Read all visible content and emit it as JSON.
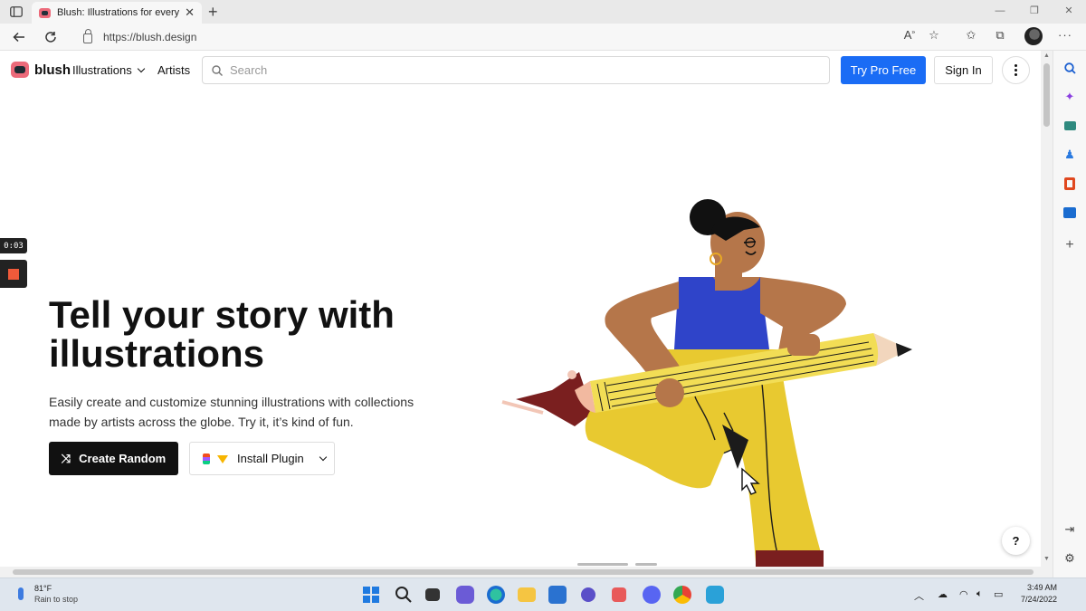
{
  "browser": {
    "tab_title": "Blush: Illustrations for everyone",
    "tab_close": "✕",
    "new_tab": "+",
    "url": "https://blush.design",
    "window_controls": [
      "—",
      "❐",
      "✕"
    ],
    "more_label": "···"
  },
  "site": {
    "logo_text": "blush",
    "nav_illustrations": "Illustrations",
    "nav_artists": "Artists",
    "search_placeholder": "Search",
    "try_pro": "Try Pro Free",
    "sign_in": "Sign In"
  },
  "hero": {
    "title": "Tell your story with illustrations",
    "subtitle": "Easily create and customize stunning illustrations with collections made by artists across the globe. Try it, it’s kind of fun.",
    "create_random": "Create Random",
    "install_plugin": "Install Plugin",
    "help": "?"
  },
  "recorder": {
    "time": "0:03"
  },
  "taskbar": {
    "weather_temp": "81°F",
    "weather_desc": "Rain to stop",
    "time": "3:49 AM",
    "date": "7/24/2022"
  },
  "colors": {
    "accent_blue": "#1a6cf5",
    "brand_pink": "#ec6a7a",
    "pencil_yellow": "#f2dd55",
    "pants_yellow": "#e8c930",
    "tank_blue": "#2f44c9",
    "skin": "#b5764a"
  }
}
